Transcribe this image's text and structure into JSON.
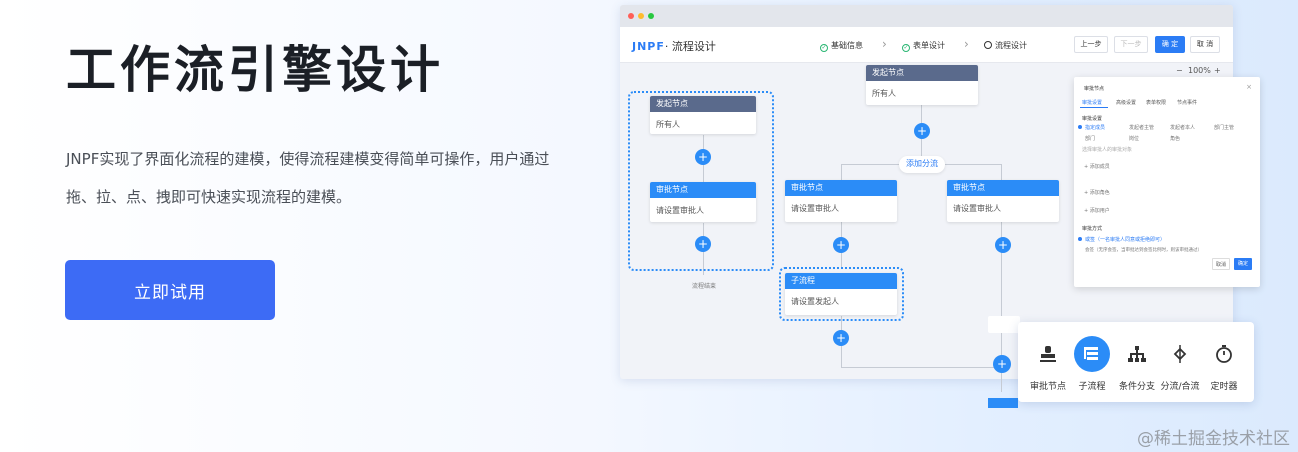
{
  "hero": {
    "title": "工作流引擎设计",
    "description": "JNPF实现了界面化流程的建模，使得流程建模变得简单可操作，用户通过拖、拉、点、拽即可快速实现流程的建模。",
    "cta_label": "立即试用"
  },
  "app": {
    "logo_brand": "JNPF",
    "logo_sub": "· 流程设计",
    "steps": [
      {
        "label": "基础信息",
        "state": "done"
      },
      {
        "label": "表单设计",
        "state": "done"
      },
      {
        "label": "流程设计",
        "state": "current"
      }
    ],
    "buttons": {
      "prev": "上一步",
      "next": "下一步",
      "confirm": "确 定",
      "cancel": "取 消"
    },
    "zoom": {
      "minus": "−",
      "value": "100%",
      "plus": "+"
    }
  },
  "flow": {
    "start_node": {
      "title": "发起节点",
      "body": "所有人"
    },
    "left_start_node": {
      "title": "发起节点",
      "body": "所有人"
    },
    "left_approve_node": {
      "title": "审批节点",
      "body": "请设置审批人"
    },
    "left_end_label": "流程结束",
    "add_branch_label": "添加分流",
    "branch_left_node": {
      "title": "审批节点",
      "body": "请设置审批人"
    },
    "branch_right_node": {
      "title": "审批节点",
      "body": "请设置审批人"
    },
    "subflow_node": {
      "title": "子流程",
      "body": "请设置发起人"
    }
  },
  "panel": {
    "title": "审批节点",
    "close": "×",
    "tabs": [
      "审批设置",
      "高级设置",
      "表单权限",
      "节点事件"
    ],
    "section1": "审批设置",
    "options_row1": [
      "指定成员",
      "发起者主管",
      "发起者本人",
      "部门主管"
    ],
    "options_row2": [
      "部门",
      "岗位",
      "角色"
    ],
    "hint": "选择审批人的审批对象",
    "items": [
      "添加成员",
      "添加角色",
      "添加用户"
    ],
    "section2": "审批方式",
    "mode_text": "或签（一名审批人同意或拒绝即可）",
    "mode_sub": "会签（无序会签，当审批达到会签比例时，则该审批通过）",
    "cancel": "取消",
    "ok": "确定"
  },
  "toolbox": {
    "items": [
      {
        "label": "审批节点",
        "icon": "stamp-icon"
      },
      {
        "label": "子流程",
        "icon": "subflow-icon"
      },
      {
        "label": "条件分支",
        "icon": "branch-icon"
      },
      {
        "label": "分流/合流",
        "icon": "split-merge-icon"
      },
      {
        "label": "定时器",
        "icon": "timer-icon"
      }
    ]
  },
  "watermark": "@稀土掘金技术社区",
  "colors": {
    "accent": "#2b8cf7",
    "cta": "#3d6bf5",
    "node_gray": "#5a6a8c"
  }
}
